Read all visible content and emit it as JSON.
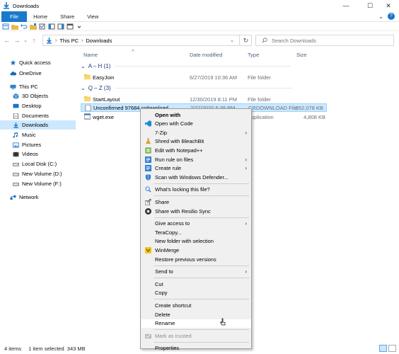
{
  "window": {
    "title": "Downloads",
    "controls": {
      "minimize": "—",
      "maximize": "☐",
      "close": "✕"
    }
  },
  "ribbon": {
    "tabs": [
      "File",
      "Home",
      "Share",
      "View"
    ],
    "collapse_glyph": "⌄",
    "help_glyph": "?"
  },
  "address": {
    "segments": [
      "This PC",
      "Downloads"
    ],
    "separator": "›",
    "dropdown_glyph": "⌄",
    "refresh_glyph": "↻",
    "search_placeholder": "Search Downloads"
  },
  "nav": {
    "back": "←",
    "forward": "→",
    "recent": "⌄",
    "up": "↑"
  },
  "sidebar": {
    "items": [
      {
        "label": "Quick access",
        "icon": "star-icon",
        "color": "#1a73c9"
      },
      {
        "label": "OneDrive",
        "icon": "cloud-icon",
        "color": "#0f6cbd"
      },
      {
        "label": "This PC",
        "icon": "monitor-icon",
        "color": "#2d7fd2"
      },
      {
        "label": "3D Objects",
        "icon": "cube-icon",
        "color": "#3b8ed6"
      },
      {
        "label": "Desktop",
        "icon": "desktop-icon",
        "color": "#1a73c9"
      },
      {
        "label": "Documents",
        "icon": "document-icon",
        "color": "#555555"
      },
      {
        "label": "Downloads",
        "icon": "download-icon",
        "color": "#1a73c9",
        "selected": true
      },
      {
        "label": "Music",
        "icon": "music-icon",
        "color": "#1a73c9"
      },
      {
        "label": "Pictures",
        "icon": "pictures-icon",
        "color": "#2d7fd2"
      },
      {
        "label": "Videos",
        "icon": "videos-icon",
        "color": "#555555"
      },
      {
        "label": "Local Disk (C:)",
        "icon": "drive-icon",
        "color": "#555555"
      },
      {
        "label": "New Volume (D:)",
        "icon": "drive-icon",
        "color": "#555555"
      },
      {
        "label": "New Volume (F:)",
        "icon": "drive-icon",
        "color": "#555555"
      },
      {
        "label": "Network",
        "icon": "network-icon",
        "color": "#1a73c9"
      }
    ]
  },
  "columns": {
    "name": "Name",
    "date": "Date modified",
    "type": "Type",
    "size": "Size",
    "sort_glyph": "^"
  },
  "groups": [
    {
      "label": "A – H (1)",
      "files": [
        {
          "name": "EasyJoin",
          "date": "6/27/2019 10:36 AM",
          "type": "File folder",
          "size": "",
          "icon": "folder-icon"
        }
      ]
    },
    {
      "label": "Q – Z (3)",
      "files": [
        {
          "name": "StartLayout",
          "date": "12/30/2019 8:11 PM",
          "type": "File folder",
          "size": "",
          "icon": "folder-icon"
        },
        {
          "name": "Unconfirmed 97684.crdownload",
          "date": "2/27/2020 5:39 PM",
          "type": "CRDOWNLOAD File",
          "size": "352,078 KB",
          "icon": "file-icon",
          "selected": true
        },
        {
          "name": "wget.exe",
          "date": "",
          "type": "Application",
          "size": "4,808 KB",
          "icon": "exe-icon"
        }
      ]
    }
  ],
  "context_menu": {
    "items": [
      {
        "label": "Open with",
        "bold": true
      },
      {
        "label": "Open with Code",
        "icon": "vscode-icon"
      },
      {
        "label": "7-Zip",
        "submenu": true
      },
      {
        "label": "Shred with BleachBit",
        "icon": "bleachbit-icon"
      },
      {
        "label": "Edit with Notepad++",
        "icon": "notepadpp-icon"
      },
      {
        "label": "Run rule on files",
        "icon": "rule-icon",
        "submenu": true
      },
      {
        "label": "Create rule",
        "icon": "rule-icon",
        "submenu": true
      },
      {
        "label": "Scan with Windows Defender...",
        "icon": "defender-icon"
      },
      {
        "separator": true
      },
      {
        "label": "What's locking this file?",
        "icon": "lock-search-icon"
      },
      {
        "separator": true
      },
      {
        "label": "Share",
        "icon": "share-icon"
      },
      {
        "label": "Share with Resilio Sync",
        "icon": "resilio-icon"
      },
      {
        "separator": true
      },
      {
        "label": "Give access to",
        "submenu": true
      },
      {
        "label": "TeraCopy..."
      },
      {
        "label": "New folder with selection"
      },
      {
        "label": "WinMerge",
        "icon": "winmerge-icon"
      },
      {
        "label": "Restore previous versions"
      },
      {
        "separator": true
      },
      {
        "label": "Send to",
        "submenu": true
      },
      {
        "separator": true
      },
      {
        "label": "Cut"
      },
      {
        "label": "Copy"
      },
      {
        "separator": true
      },
      {
        "label": "Create shortcut"
      },
      {
        "label": "Delete"
      },
      {
        "label": "Rename",
        "hover": true
      },
      {
        "separator": true
      },
      {
        "label": "Mark as trusted",
        "icon": "trusted-icon",
        "disabled": true
      },
      {
        "separator": true
      },
      {
        "label": "Properties"
      }
    ]
  },
  "status": {
    "items": "4 items",
    "selection": "1 item selected  343 MB"
  },
  "colors": {
    "accent": "#1979ca",
    "selection": "#cce8ff",
    "group_header": "#1e3287"
  }
}
